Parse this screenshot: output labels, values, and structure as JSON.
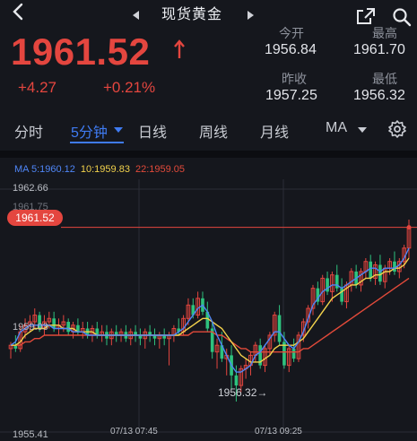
{
  "header": {
    "title": "现货黄金"
  },
  "quote": {
    "price": "1961.52",
    "change": "+4.27",
    "change_pct": "+0.21%",
    "open_label": "今开",
    "open": "1956.84",
    "high_label": "最高",
    "high": "1961.70",
    "prev_close_label": "昨收",
    "prev_close": "1957.25",
    "low_label": "最低",
    "low": "1956.32"
  },
  "tabs": [
    {
      "label": "分时",
      "active": false
    },
    {
      "label": "5分钟",
      "active": true
    },
    {
      "label": "日线",
      "active": false
    },
    {
      "label": "周线",
      "active": false
    },
    {
      "label": "月线",
      "active": false
    },
    {
      "label": "MA",
      "active": false
    }
  ],
  "ma": {
    "ma5": "MA 5:1960.12",
    "ma10": "10:1959.83",
    "ma22": "22:1959.05",
    "colors": {
      "label": "#c9ccd3",
      "ma5": "#4f86f7",
      "ma10": "#f2d24c",
      "ma22": "#e24a3a"
    }
  },
  "chart": {
    "y_top": "1962.66",
    "y_mid": "1959.03",
    "y_bottom": "1955.41",
    "y_hidden": "1961.75",
    "current_badge": "1961.52",
    "min_label": "1956.32→",
    "x_labels": [
      "07/13 07:45",
      "07/13 09:25"
    ],
    "colors": {
      "up": "#e4463f",
      "down": "#2ec27e",
      "grid": "#2b2e36"
    }
  },
  "chart_data": {
    "type": "candlestick",
    "y_range": [
      1955.41,
      1962.66
    ],
    "current_price": 1961.52,
    "min_marker": 1956.32,
    "candles": [
      [
        1957.9,
        1958.1,
        1957.6,
        1958.0
      ],
      [
        1958.0,
        1958.3,
        1957.8,
        1957.9
      ],
      [
        1957.9,
        1958.6,
        1957.8,
        1958.4
      ],
      [
        1958.4,
        1958.8,
        1958.2,
        1958.6
      ],
      [
        1958.6,
        1958.9,
        1958.4,
        1958.7
      ],
      [
        1958.7,
        1959.1,
        1958.5,
        1958.9
      ],
      [
        1958.9,
        1959.0,
        1958.4,
        1958.5
      ],
      [
        1958.5,
        1958.9,
        1958.3,
        1958.7
      ],
      [
        1958.7,
        1959.0,
        1958.5,
        1958.8
      ],
      [
        1958.8,
        1959.0,
        1958.4,
        1958.5
      ],
      [
        1958.5,
        1958.8,
        1958.3,
        1958.6
      ],
      [
        1958.6,
        1958.9,
        1958.4,
        1958.7
      ],
      [
        1958.7,
        1958.8,
        1958.3,
        1958.4
      ],
      [
        1958.4,
        1958.7,
        1958.2,
        1958.6
      ],
      [
        1958.6,
        1958.8,
        1958.3,
        1958.4
      ],
      [
        1958.4,
        1958.7,
        1958.2,
        1958.5
      ],
      [
        1958.5,
        1958.7,
        1958.2,
        1958.3
      ],
      [
        1958.3,
        1958.6,
        1958.1,
        1958.5
      ],
      [
        1958.5,
        1958.7,
        1958.2,
        1958.3
      ],
      [
        1958.3,
        1958.6,
        1958.1,
        1958.4
      ],
      [
        1958.4,
        1958.6,
        1958.0,
        1958.2
      ],
      [
        1958.2,
        1958.5,
        1958.0,
        1958.4
      ],
      [
        1958.4,
        1958.6,
        1958.1,
        1958.3
      ],
      [
        1958.3,
        1958.5,
        1958.1,
        1958.4
      ],
      [
        1958.4,
        1958.6,
        1958.1,
        1958.2
      ],
      [
        1958.2,
        1958.5,
        1958.0,
        1958.4
      ],
      [
        1958.4,
        1958.6,
        1958.1,
        1958.3
      ],
      [
        1958.3,
        1958.5,
        1958.0,
        1958.2
      ],
      [
        1958.2,
        1958.5,
        1957.9,
        1958.4
      ],
      [
        1958.4,
        1958.6,
        1958.1,
        1958.3
      ],
      [
        1958.3,
        1958.5,
        1958.0,
        1958.2
      ],
      [
        1958.2,
        1958.4,
        1957.9,
        1958.3
      ],
      [
        1958.3,
        1958.5,
        1958.0,
        1958.2
      ],
      [
        1958.2,
        1958.4,
        1957.4,
        1958.3
      ],
      [
        1958.3,
        1958.6,
        1958.1,
        1958.5
      ],
      [
        1958.5,
        1958.8,
        1958.3,
        1958.4
      ],
      [
        1958.4,
        1958.9,
        1958.3,
        1958.8
      ],
      [
        1958.8,
        1959.4,
        1958.6,
        1959.2
      ],
      [
        1959.2,
        1959.4,
        1958.8,
        1958.9
      ],
      [
        1958.9,
        1959.6,
        1958.8,
        1959.4
      ],
      [
        1959.4,
        1959.6,
        1958.9,
        1959.0
      ],
      [
        1959.0,
        1959.3,
        1958.4,
        1958.5
      ],
      [
        1958.5,
        1958.7,
        1957.6,
        1957.8
      ],
      [
        1957.8,
        1958.2,
        1957.3,
        1958.0
      ],
      [
        1958.0,
        1958.4,
        1957.5,
        1957.6
      ],
      [
        1957.6,
        1957.9,
        1957.1,
        1957.7
      ],
      [
        1957.7,
        1958.0,
        1956.7,
        1957.1
      ],
      [
        1957.1,
        1957.4,
        1956.32,
        1956.8
      ],
      [
        1956.8,
        1957.4,
        1956.6,
        1957.3
      ],
      [
        1957.3,
        1957.6,
        1957.0,
        1957.4
      ],
      [
        1957.4,
        1957.8,
        1957.1,
        1957.7
      ],
      [
        1957.7,
        1958.1,
        1957.5,
        1958.0
      ],
      [
        1958.0,
        1958.2,
        1957.3,
        1957.4
      ],
      [
        1957.4,
        1958.0,
        1957.2,
        1957.9
      ],
      [
        1957.9,
        1958.4,
        1957.7,
        1958.3
      ],
      [
        1958.3,
        1959.0,
        1958.1,
        1958.9
      ],
      [
        1958.9,
        1959.2,
        1958.0,
        1958.1
      ],
      [
        1958.1,
        1958.4,
        1957.3,
        1957.4
      ],
      [
        1957.4,
        1958.0,
        1957.2,
        1957.9
      ],
      [
        1957.9,
        1958.2,
        1957.5,
        1957.6
      ],
      [
        1957.6,
        1958.4,
        1957.5,
        1958.3
      ],
      [
        1958.3,
        1958.8,
        1958.1,
        1958.7
      ],
      [
        1958.7,
        1959.2,
        1958.5,
        1959.1
      ],
      [
        1959.1,
        1959.8,
        1958.9,
        1959.7
      ],
      [
        1959.7,
        1959.9,
        1959.2,
        1959.3
      ],
      [
        1959.3,
        1960.1,
        1959.2,
        1960.0
      ],
      [
        1960.0,
        1960.2,
        1959.5,
        1959.6
      ],
      [
        1959.6,
        1960.2,
        1959.3,
        1960.1
      ],
      [
        1960.1,
        1960.4,
        1959.6,
        1959.7
      ],
      [
        1959.7,
        1960.0,
        1959.2,
        1959.3
      ],
      [
        1959.3,
        1959.9,
        1959.1,
        1959.8
      ],
      [
        1959.8,
        1960.3,
        1959.6,
        1960.2
      ],
      [
        1960.2,
        1960.4,
        1959.7,
        1959.8
      ],
      [
        1959.8,
        1960.3,
        1959.6,
        1960.2
      ],
      [
        1960.2,
        1960.6,
        1960.0,
        1960.5
      ],
      [
        1960.5,
        1960.7,
        1959.9,
        1960.0
      ],
      [
        1960.0,
        1960.5,
        1959.8,
        1960.4
      ],
      [
        1960.4,
        1960.7,
        1959.8,
        1959.9
      ],
      [
        1959.9,
        1960.4,
        1959.7,
        1960.3
      ],
      [
        1960.3,
        1960.6,
        1960.1,
        1960.5
      ],
      [
        1960.5,
        1960.8,
        1960.1,
        1960.2
      ],
      [
        1960.2,
        1960.6,
        1960.0,
        1960.5
      ],
      [
        1960.5,
        1961.0,
        1960.3,
        1960.9
      ],
      [
        1960.9,
        1961.75,
        1960.6,
        1961.52
      ]
    ],
    "ma5": [
      1958.0,
      1958.1,
      1958.4,
      1958.5,
      1958.6,
      1958.6,
      1958.6,
      1958.6,
      1958.6,
      1958.5,
      1958.5,
      1958.5,
      1958.5,
      1958.4,
      1958.4,
      1958.4,
      1958.3,
      1958.3,
      1958.3,
      1958.3,
      1958.3,
      1958.3,
      1958.3,
      1958.3,
      1958.3,
      1958.3,
      1958.3,
      1958.3,
      1958.3,
      1958.3,
      1958.3,
      1958.3,
      1958.3,
      1958.3,
      1958.3,
      1958.4,
      1958.5,
      1958.7,
      1958.9,
      1959.1,
      1959.2,
      1959.0,
      1958.7,
      1958.3,
      1958.0,
      1957.7,
      1957.4,
      1957.2,
      1957.2,
      1957.3,
      1957.4,
      1957.7,
      1957.8,
      1958.0,
      1958.2,
      1958.4,
      1958.4,
      1958.2,
      1958.0,
      1957.9,
      1958.1,
      1958.4,
      1958.8,
      1959.2,
      1959.4,
      1959.6,
      1959.7,
      1959.8,
      1959.8,
      1959.7,
      1959.8,
      1959.9,
      1960.0,
      1960.1,
      1960.2,
      1960.3,
      1960.3,
      1960.2,
      1960.3,
      1960.3,
      1960.3,
      1960.4,
      1960.6,
      1960.9
    ],
    "ma10": [
      1958.0,
      1958.0,
      1958.1,
      1958.3,
      1958.4,
      1958.5,
      1958.5,
      1958.5,
      1958.6,
      1958.6,
      1958.6,
      1958.5,
      1958.5,
      1958.5,
      1958.4,
      1958.4,
      1958.4,
      1958.4,
      1958.3,
      1958.3,
      1958.3,
      1958.3,
      1958.3,
      1958.3,
      1958.3,
      1958.3,
      1958.3,
      1958.3,
      1958.3,
      1958.3,
      1958.3,
      1958.3,
      1958.3,
      1958.3,
      1958.3,
      1958.3,
      1958.4,
      1958.5,
      1958.6,
      1958.7,
      1958.8,
      1958.8,
      1958.7,
      1958.6,
      1958.5,
      1958.3,
      1958.1,
      1957.9,
      1957.7,
      1957.6,
      1957.5,
      1957.5,
      1957.5,
      1957.6,
      1957.7,
      1957.9,
      1958.0,
      1958.0,
      1958.0,
      1958.0,
      1958.1,
      1958.2,
      1958.4,
      1958.6,
      1958.8,
      1959.0,
      1959.2,
      1959.4,
      1959.5,
      1959.6,
      1959.7,
      1959.8,
      1959.8,
      1959.9,
      1960.0,
      1960.0,
      1960.1,
      1960.1,
      1960.2,
      1960.2,
      1960.3,
      1960.3,
      1960.4,
      1960.6
    ],
    "ma22": [
      1958.0,
      1958.0,
      1958.0,
      1958.1,
      1958.1,
      1958.2,
      1958.2,
      1958.3,
      1958.3,
      1958.3,
      1958.3,
      1958.3,
      1958.3,
      1958.3,
      1958.3,
      1958.3,
      1958.3,
      1958.3,
      1958.3,
      1958.3,
      1958.3,
      1958.3,
      1958.3,
      1958.3,
      1958.3,
      1958.3,
      1958.3,
      1958.3,
      1958.3,
      1958.3,
      1958.3,
      1958.3,
      1958.3,
      1958.3,
      1958.3,
      1958.3,
      1958.3,
      1958.3,
      1958.4,
      1958.4,
      1958.4,
      1958.4,
      1958.4,
      1958.3,
      1958.3,
      1958.2,
      1958.1,
      1958.0,
      1957.9,
      1957.9,
      1957.8,
      1957.8,
      1957.8,
      1957.8,
      1957.8,
      1957.8,
      1957.8,
      1957.8,
      1957.8,
      1957.8,
      1957.8,
      1957.9,
      1957.9,
      1958.0,
      1958.1,
      1958.2,
      1958.3,
      1958.4,
      1958.5,
      1958.6,
      1958.7,
      1958.8,
      1958.9,
      1959.0,
      1959.1,
      1959.2,
      1959.3,
      1959.4,
      1959.5,
      1959.6,
      1959.7,
      1959.8,
      1959.9,
      1960.0
    ]
  }
}
